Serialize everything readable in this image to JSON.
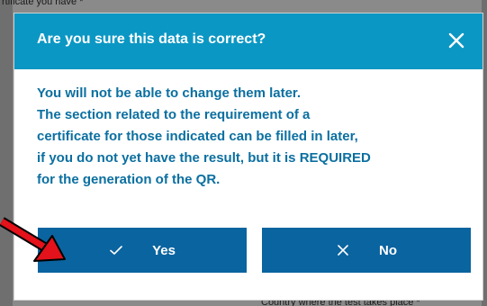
{
  "background": {
    "top_text": "rtificate you have *",
    "bottom_text": "Country where the test takes place *"
  },
  "dialog": {
    "title": "Are you sure this data is correct?",
    "close_icon": "close-icon",
    "body_lines": [
      "You will not be able to change them later.",
      "The section related to the requirement of a",
      "certificate for those indicated can be filled in later,",
      "if you do not yet have the result, but it is REQUIRED",
      "for the generation of the QR."
    ],
    "yes_label": "Yes",
    "yes_icon": "check-icon",
    "no_label": "No",
    "no_icon": "x-icon"
  },
  "colors": {
    "header": "#0b97c4",
    "body_text": "#0b6fa0",
    "button": "#0a64a0",
    "annotation_arrow": "#e3121b"
  }
}
